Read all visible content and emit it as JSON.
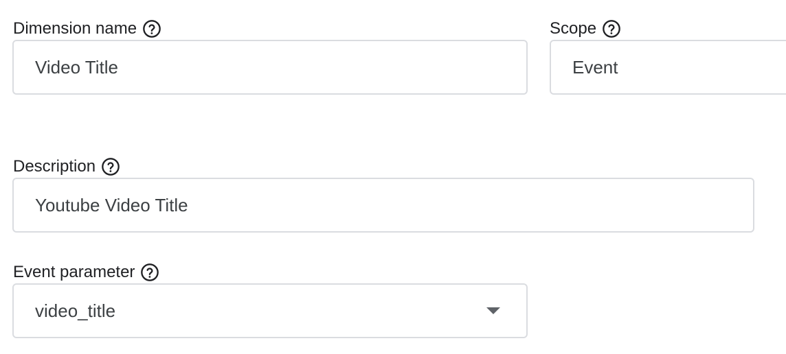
{
  "dimension_name": {
    "label": "Dimension name",
    "value": "Video Title",
    "help_icon": "help-circle-icon"
  },
  "scope": {
    "label": "Scope",
    "value": "Event",
    "help_icon": "help-circle-icon"
  },
  "description": {
    "label": "Description",
    "value": "Youtube Video Title",
    "help_icon": "help-circle-icon"
  },
  "event_parameter": {
    "label": "Event parameter",
    "value": "video_title",
    "help_icon": "help-circle-icon",
    "dropdown_icon": "chevron-down-icon"
  },
  "colors": {
    "text": "#202124",
    "field_text": "#3c4043",
    "border": "#dadce0",
    "icon": "#202124"
  }
}
